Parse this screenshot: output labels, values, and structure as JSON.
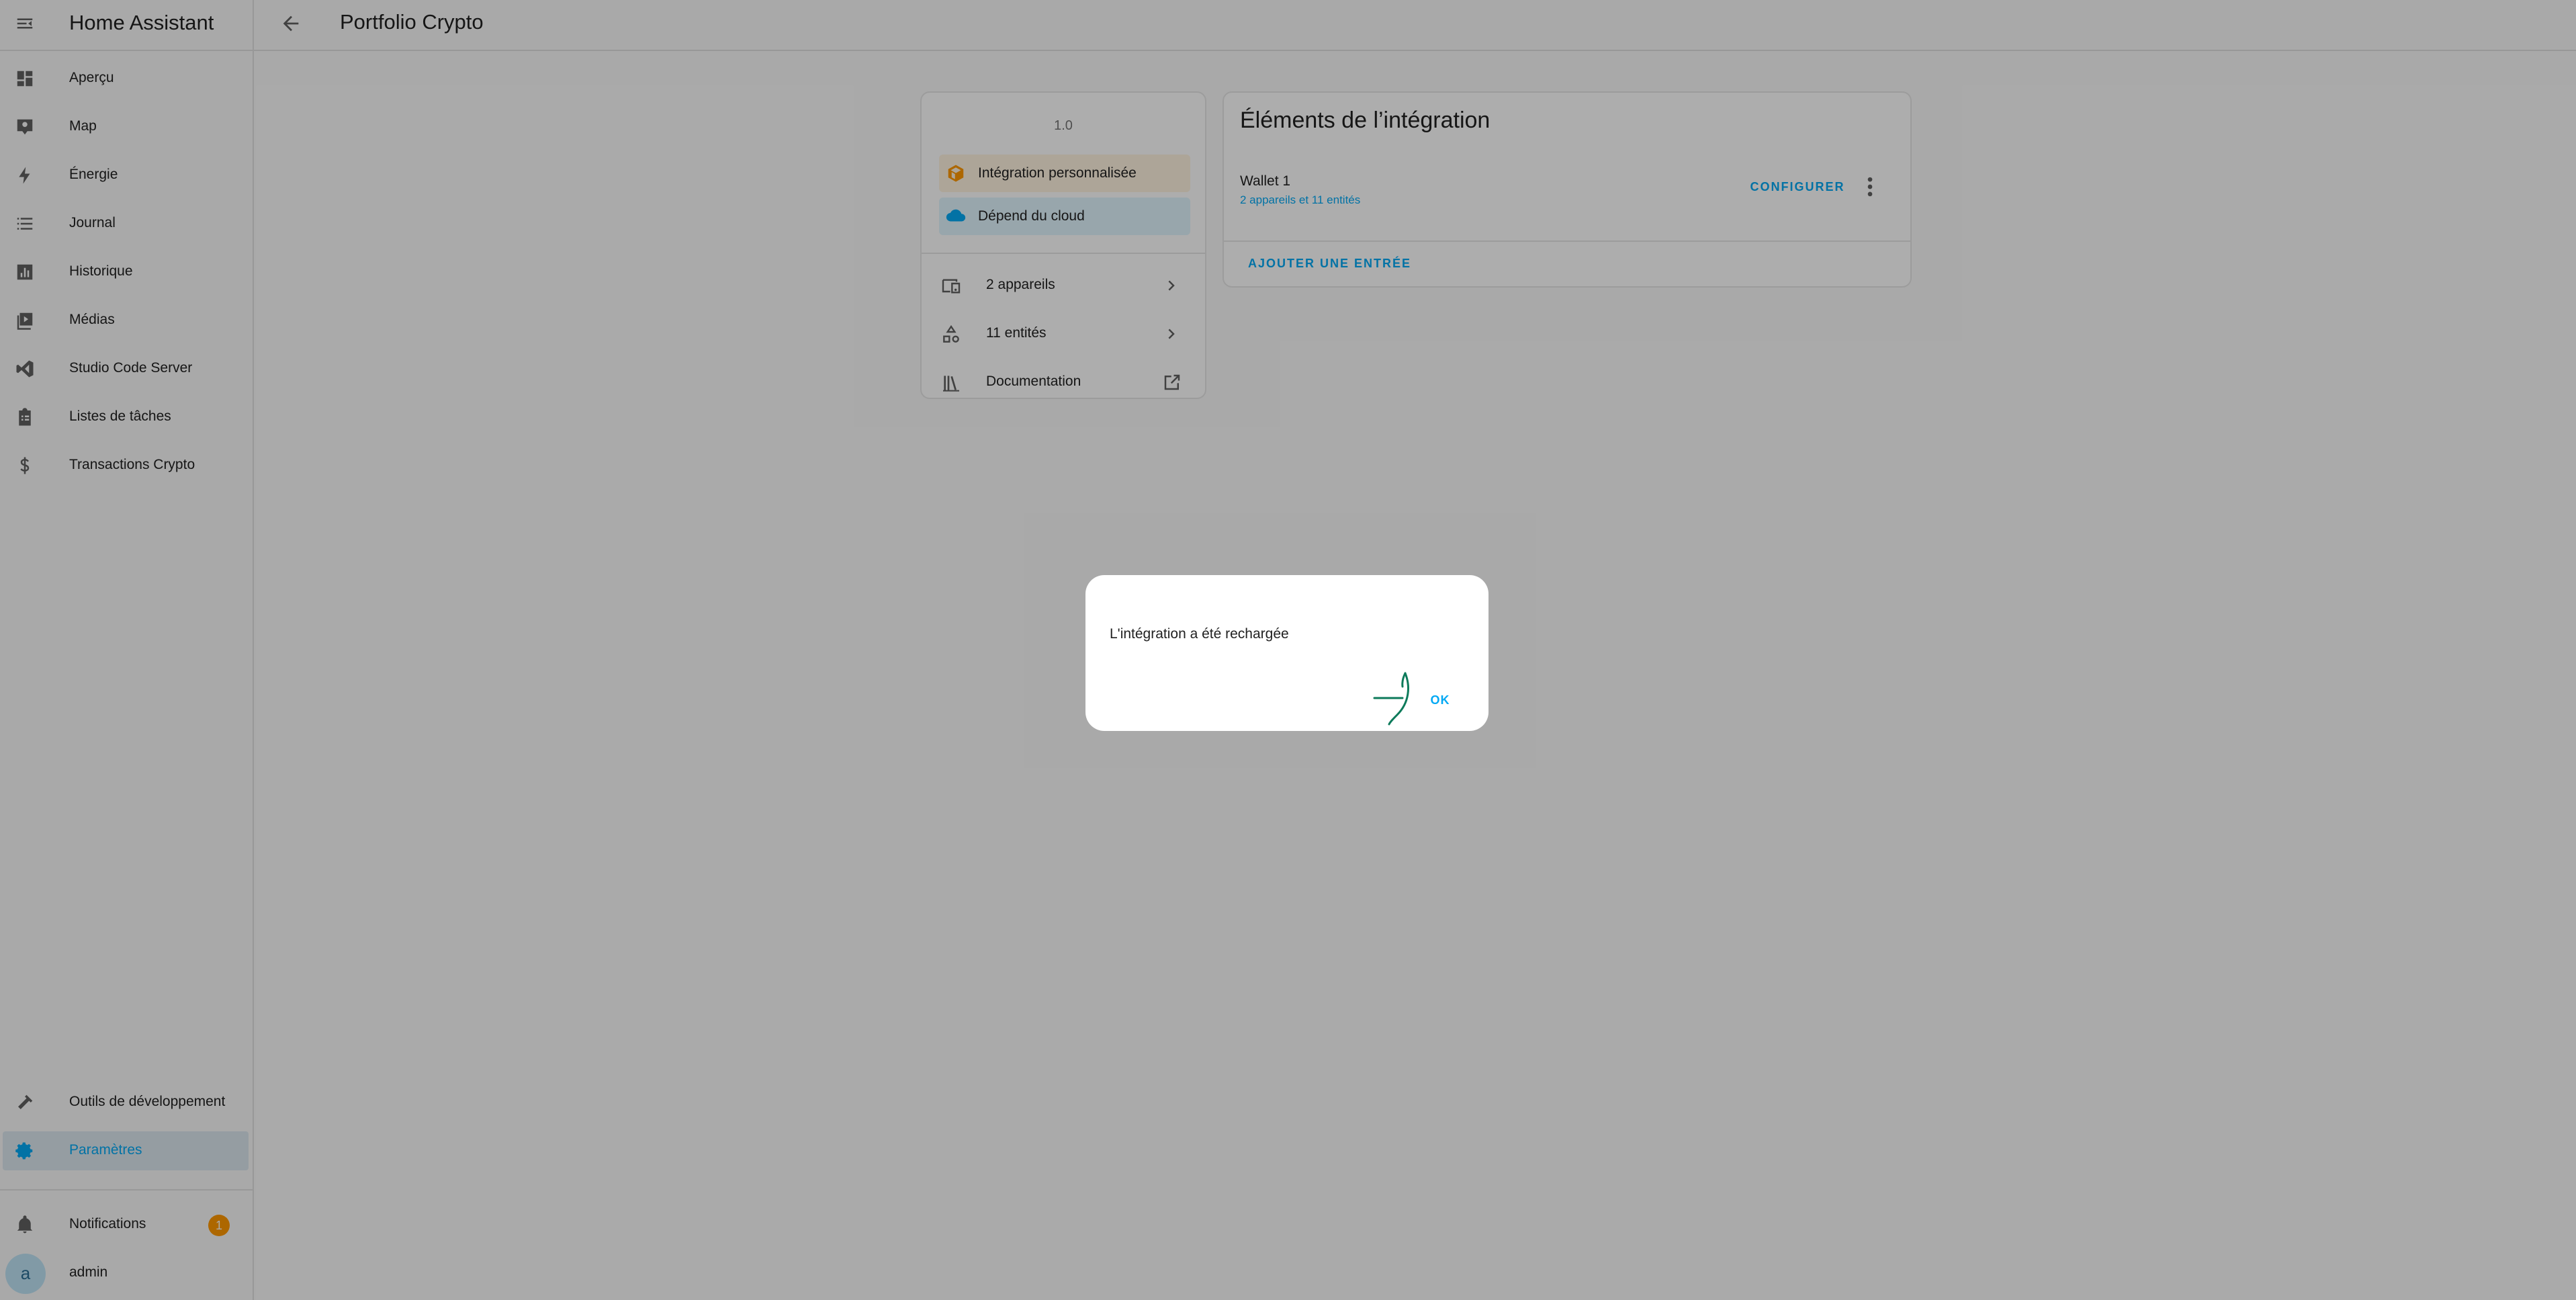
{
  "sidebar": {
    "title": "Home Assistant",
    "items": [
      {
        "label": "Aperçu",
        "icon": "dashboard-icon"
      },
      {
        "label": "Map",
        "icon": "map-icon"
      },
      {
        "label": "Énergie",
        "icon": "lightning-icon"
      },
      {
        "label": "Journal",
        "icon": "list-icon"
      },
      {
        "label": "Historique",
        "icon": "chart-icon"
      },
      {
        "label": "Médias",
        "icon": "media-icon"
      },
      {
        "label": "Studio Code Server",
        "icon": "vscode-icon"
      },
      {
        "label": "Listes de tâches",
        "icon": "clipboard-icon"
      },
      {
        "label": "Transactions Crypto",
        "icon": "dollar-icon"
      }
    ],
    "bottom_items": [
      {
        "label": "Outils de développement",
        "icon": "hammer-icon"
      },
      {
        "label": "Paramètres",
        "icon": "gear-icon",
        "active": true
      }
    ],
    "notifications": {
      "label": "Notifications",
      "count": "1"
    },
    "user": {
      "initial": "a",
      "name": "admin"
    }
  },
  "header": {
    "title": "Portfolio Crypto"
  },
  "info_card": {
    "version": "1.0",
    "custom_chip": "Intégration personnalisée",
    "cloud_chip": "Dépend du cloud",
    "devices": "2 appareils",
    "entities": "11 entités",
    "documentation": "Documentation"
  },
  "entries_card": {
    "title": "Éléments de l’intégration",
    "entry_name": "Wallet 1",
    "entry_sub": "2 appareils et 11 entités",
    "configure": "CONFIGURER",
    "add_entry": "AJOUTER UNE ENTRÉE"
  },
  "dialog": {
    "message": "L'intégration a été rechargée",
    "ok": "OK"
  },
  "colors": {
    "accent": "#03a9f4",
    "badge": "#ff9800",
    "active_bg": "#dce8ef",
    "custom_chip_bg": "#fff3e0",
    "cloud_chip_bg": "#e1f5fe"
  }
}
